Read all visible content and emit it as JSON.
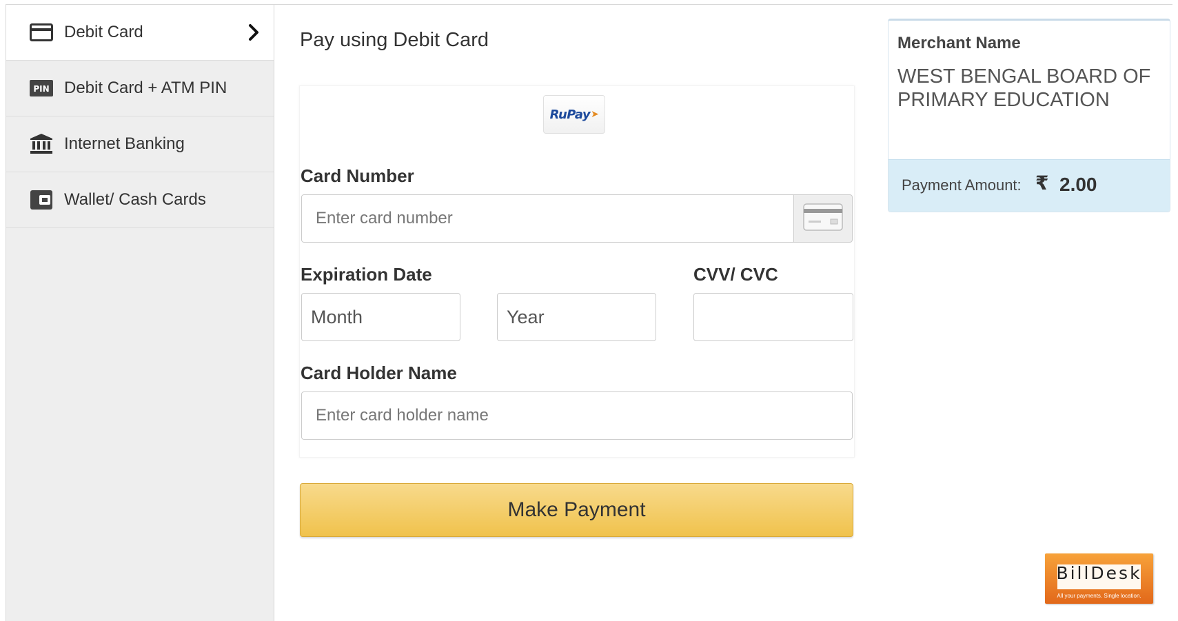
{
  "sidebar": {
    "items": [
      {
        "label": "Debit Card",
        "icon": "credit-card-icon",
        "active": true
      },
      {
        "label": "Debit Card + ATM PIN",
        "icon": "pin-icon",
        "icon_text": "PIN",
        "active": false
      },
      {
        "label": "Internet Banking",
        "icon": "bank-icon",
        "active": false
      },
      {
        "label": "Wallet/ Cash Cards",
        "icon": "wallet-icon",
        "active": false
      }
    ]
  },
  "main": {
    "title": "Pay using Debit Card",
    "card_logo": {
      "text": "RuPay",
      "name": "rupay-logo"
    },
    "card_number": {
      "label": "Card Number",
      "placeholder": "Enter card number",
      "value": ""
    },
    "expiration": {
      "label": "Expiration Date",
      "month_selected": "Month",
      "year_selected": "Year"
    },
    "cvv": {
      "label": "CVV/ CVC",
      "value": ""
    },
    "holder": {
      "label": "Card Holder Name",
      "placeholder": "Enter card holder name",
      "value": ""
    },
    "pay_button": "Make Payment"
  },
  "merchant": {
    "label": "Merchant Name",
    "name": "WEST BENGAL BOARD OF PRIMARY EDUCATION",
    "amount_label": "Payment Amount:",
    "currency_symbol": "₹",
    "amount": "2.00"
  },
  "branding": {
    "logo_text": "BillDesk",
    "tagline": "All your payments. Single location."
  },
  "colors": {
    "pay_button": "#f0c24c",
    "amount_bar": "#d9edf7",
    "sidebar_bg": "#eeeeee",
    "billdesk_orange": "#e2681a"
  }
}
